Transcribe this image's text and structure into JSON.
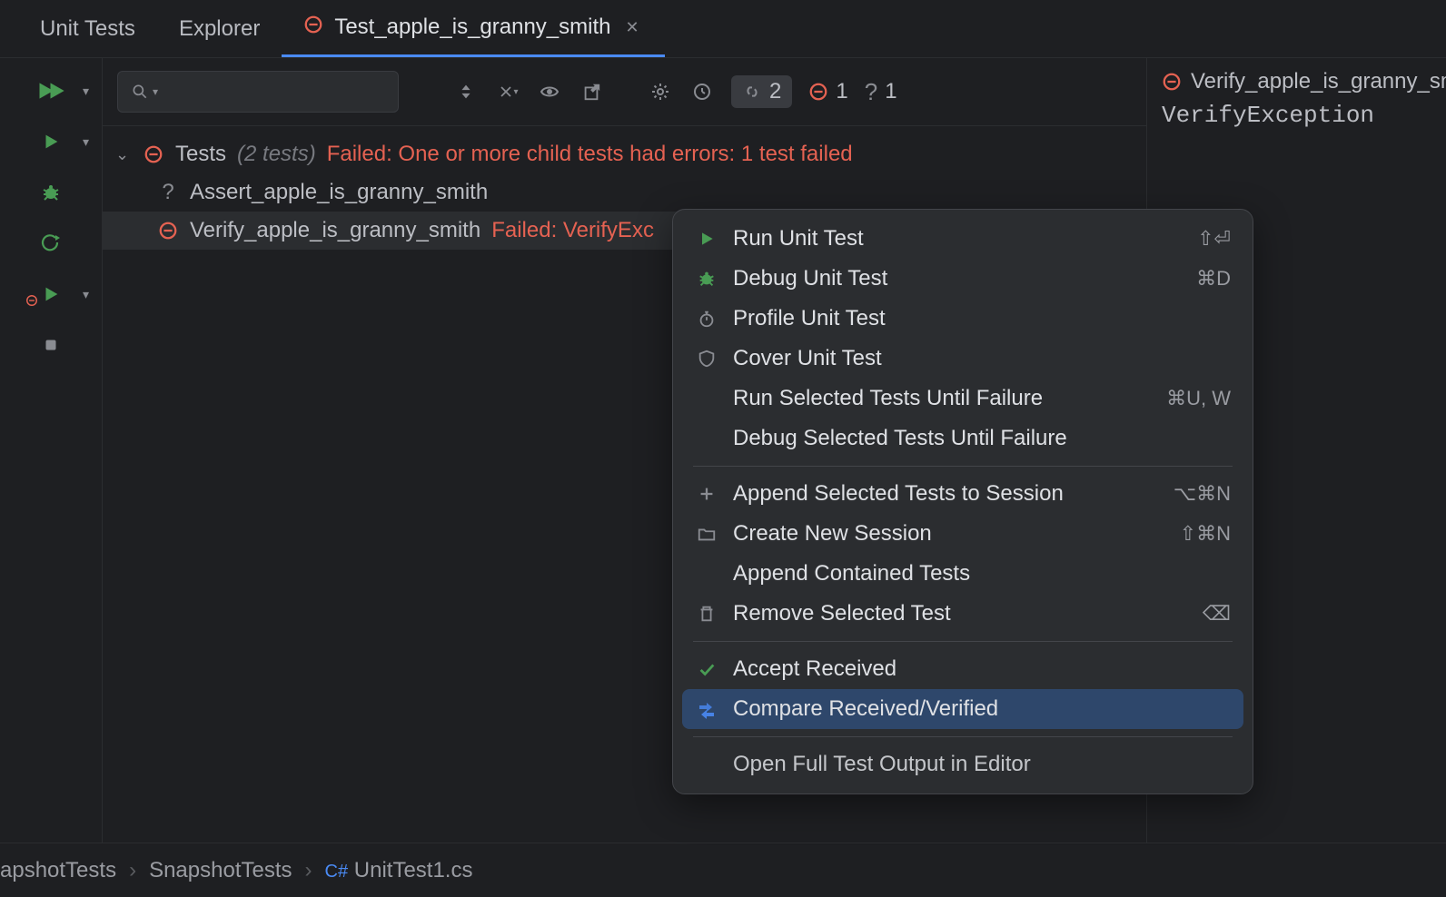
{
  "tabs": {
    "unit_tests": "Unit Tests",
    "explorer": "Explorer",
    "active": "Test_apple_is_granny_smith"
  },
  "toolbar": {
    "link_count": "2",
    "fail_count": "1",
    "unknown_count": "1"
  },
  "tree": {
    "root": "Tests",
    "root_count": "(2 tests)",
    "root_fail": "Failed: One or more child tests had errors: 1 test failed",
    "item1": "Assert_apple_is_granny_smith",
    "item2": "Verify_apple_is_granny_smith",
    "item2_fail": "Failed: VerifyExc"
  },
  "details": {
    "title": "Verify_apple_is_granny_sm",
    "exception": "VerifyException"
  },
  "breadcrumb": {
    "p1": "apshotTests",
    "p2": "SnapshotTests",
    "p3_prefix": "C#",
    "p3": "UnitTest1.cs"
  },
  "menu": {
    "run": "Run Unit Test",
    "run_sc": "⇧⏎",
    "debug": "Debug Unit Test",
    "debug_sc": "⌘D",
    "profile": "Profile Unit Test",
    "cover": "Cover Unit Test",
    "run_until": "Run Selected Tests Until Failure",
    "run_until_sc": "⌘U, W",
    "debug_until": "Debug Selected Tests Until Failure",
    "append_session": "Append Selected Tests to Session",
    "append_session_sc": "⌥⌘N",
    "new_session": "Create New Session",
    "new_session_sc": "⇧⌘N",
    "append_contained": "Append Contained Tests",
    "remove": "Remove Selected Test",
    "remove_sc": "⌫",
    "accept": "Accept Received",
    "compare": "Compare Received/Verified",
    "open_output": "Open Full Test Output in Editor"
  }
}
